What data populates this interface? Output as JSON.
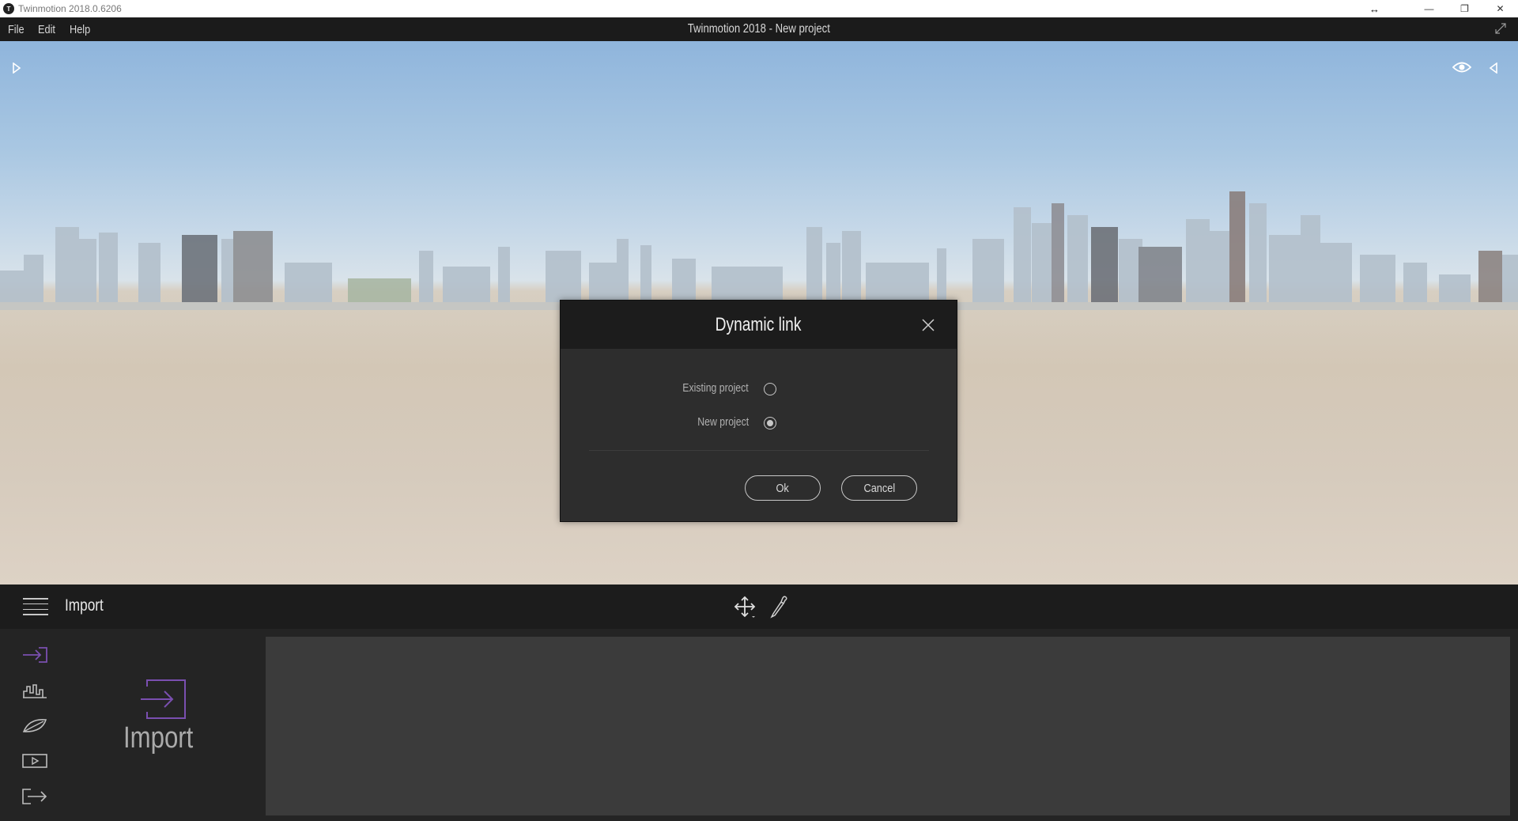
{
  "window": {
    "title": "Twinmotion 2018.0.6206",
    "app_icon_glyph": "T",
    "controls": {
      "resize_icon": "resize-arrows-icon",
      "minimize": "—",
      "restore": "❐",
      "close": "✕"
    }
  },
  "menubar": {
    "items": [
      "File",
      "Edit",
      "Help"
    ],
    "document_title": "Twinmotion 2018 - New project"
  },
  "viewport": {
    "left_toggle": "expand-left-panel-icon",
    "right_toggle": "collapse-right-panel-icon",
    "view_icon": "eye-icon"
  },
  "dialog": {
    "title": "Dynamic link",
    "options": [
      {
        "label": "Existing project",
        "checked": false
      },
      {
        "label": "New project",
        "checked": true
      }
    ],
    "ok_label": "Ok",
    "cancel_label": "Cancel"
  },
  "panel": {
    "title": "Import",
    "tools": [
      "move-gizmo-icon",
      "eyedropper-icon"
    ],
    "sidebar_icons": [
      "import-icon",
      "landscape-icon",
      "leaf-icon",
      "media-icon",
      "export-icon"
    ],
    "big_label": "Import",
    "accent_color": "#7a4fb0"
  }
}
